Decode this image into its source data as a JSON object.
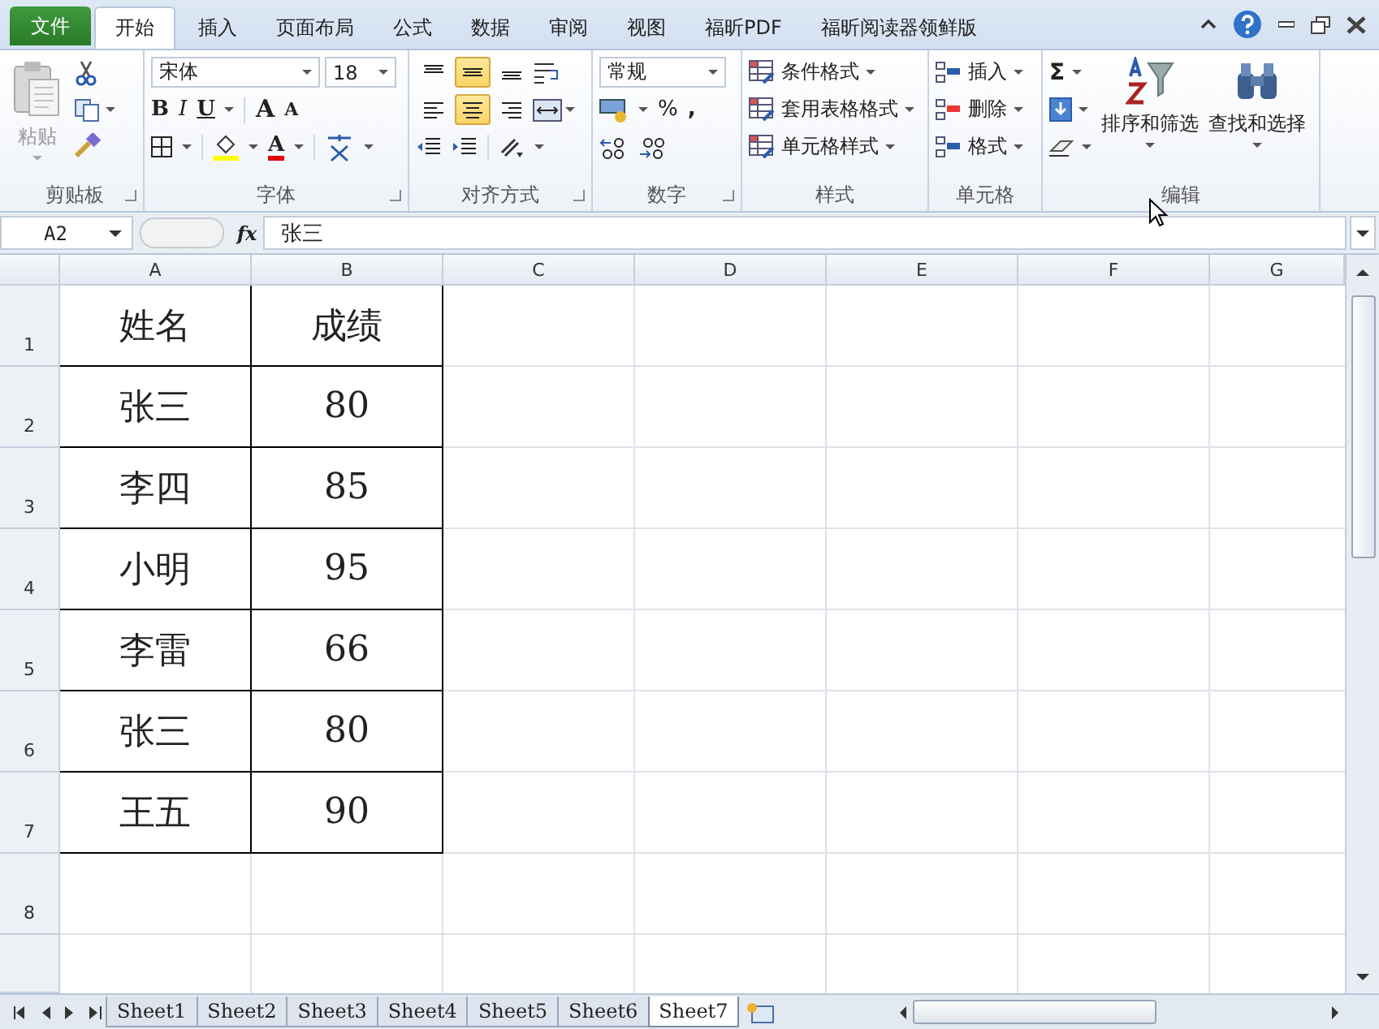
{
  "menu_tabs": [
    {
      "label": "文件",
      "kind": "file",
      "selected": false
    },
    {
      "label": "开始",
      "kind": "tab",
      "selected": true
    },
    {
      "label": "插入",
      "kind": "tab",
      "selected": false
    },
    {
      "label": "页面布局",
      "kind": "tab",
      "selected": false
    },
    {
      "label": "公式",
      "kind": "tab",
      "selected": false
    },
    {
      "label": "数据",
      "kind": "tab",
      "selected": false
    },
    {
      "label": "审阅",
      "kind": "tab",
      "selected": false
    },
    {
      "label": "视图",
      "kind": "tab",
      "selected": false
    },
    {
      "label": "福昕PDF",
      "kind": "tab",
      "selected": false
    },
    {
      "label": "福昕阅读器领鲜版",
      "kind": "tab",
      "selected": false
    }
  ],
  "ribbon": {
    "clipboard": {
      "paste": "粘贴",
      "paste_disabled": true,
      "label": "剪贴板"
    },
    "font": {
      "name": "宋体",
      "size": "18",
      "bold": "B",
      "italic": "I",
      "underline": "U",
      "grow": "A",
      "shrink": "A",
      "font_color": "A",
      "label": "字体"
    },
    "alignment": {
      "vertical": [
        {
          "selected": false
        },
        {
          "selected": true
        },
        {
          "selected": false
        }
      ],
      "horizontal": [
        {
          "selected": false
        },
        {
          "selected": true
        },
        {
          "selected": false
        }
      ],
      "label": "对齐方式"
    },
    "number": {
      "format": "常规",
      "percent": "%",
      "comma": ",",
      "label": "数字"
    },
    "styles": {
      "items": [
        "条件格式",
        "套用表格格式",
        "单元格样式"
      ],
      "label": "样式"
    },
    "cells": {
      "items": [
        "插入",
        "删除",
        "格式"
      ],
      "label": "单元格"
    },
    "editing": {
      "sum": "Σ",
      "sort": "排序和筛选",
      "find": "查找和选择",
      "label": "编辑"
    }
  },
  "formula_bar": {
    "name_box": "A2",
    "function_label": "fx",
    "value": "张三"
  },
  "columns": [
    "A",
    "B",
    "C",
    "D",
    "E",
    "F",
    "G"
  ],
  "rows": [
    "1",
    "2",
    "3",
    "4",
    "5",
    "6",
    "7",
    "8"
  ],
  "table": [
    [
      "姓名",
      "成绩"
    ],
    [
      "张三",
      "80"
    ],
    [
      "李四",
      "85"
    ],
    [
      "小明",
      "95"
    ],
    [
      "李雷",
      "66"
    ],
    [
      "张三",
      "80"
    ],
    [
      "王五",
      "90"
    ]
  ],
  "sheets": [
    {
      "label": "Sheet1",
      "selected": false
    },
    {
      "label": "Sheet2",
      "selected": false
    },
    {
      "label": "Sheet3",
      "selected": false
    },
    {
      "label": "Sheet4",
      "selected": false
    },
    {
      "label": "Sheet5",
      "selected": false
    },
    {
      "label": "Sheet6",
      "selected": false
    },
    {
      "label": "Sheet7",
      "selected": true
    }
  ]
}
